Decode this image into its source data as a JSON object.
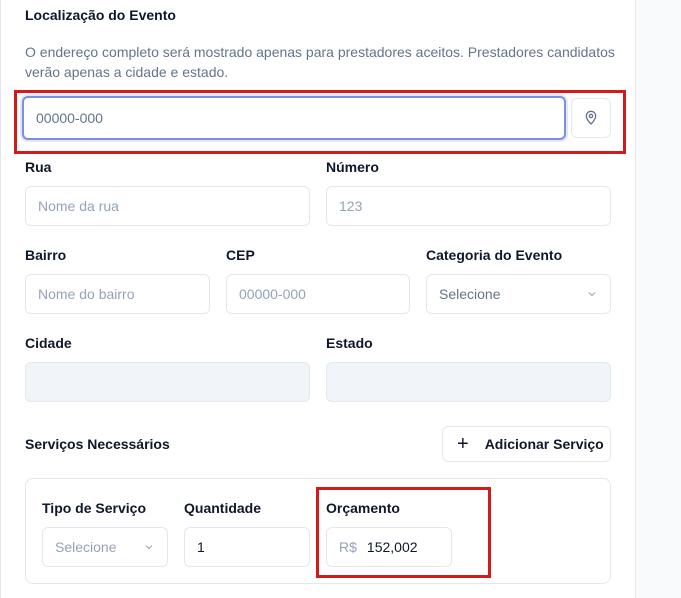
{
  "section": {
    "title": "Localização do Evento",
    "description": "O endereço completo será mostrado apenas para prestadores aceitos. Prestadores candidatos verão apenas a cidade e estado."
  },
  "location_search": {
    "placeholder": "00000-000",
    "icon": "map-pin-icon"
  },
  "fields": {
    "rua": {
      "label": "Rua",
      "placeholder": "Nome da rua"
    },
    "numero": {
      "label": "Número",
      "placeholder": "123"
    },
    "bairro": {
      "label": "Bairro",
      "placeholder": "Nome do bairro"
    },
    "cep": {
      "label": "CEP",
      "placeholder": "00000-000"
    },
    "categoria": {
      "label": "Categoria do Evento",
      "value": "Selecione"
    },
    "cidade": {
      "label": "Cidade",
      "value": ""
    },
    "estado": {
      "label": "Estado",
      "value": ""
    }
  },
  "services": {
    "title": "Serviços Necessários",
    "add_button": "Adicionar Serviço",
    "item": {
      "tipo_label": "Tipo de Serviço",
      "tipo_value": "Selecione",
      "quantidade_label": "Quantidade",
      "quantidade_value": "1",
      "orcamento_label": "Orçamento",
      "currency": "R$",
      "orcamento_value": "152,002"
    }
  },
  "colors": {
    "highlight": "#d11a1a",
    "focus_ring": "#7c8ee0",
    "muted_text": "#64748b",
    "placeholder": "#94a3b8"
  }
}
